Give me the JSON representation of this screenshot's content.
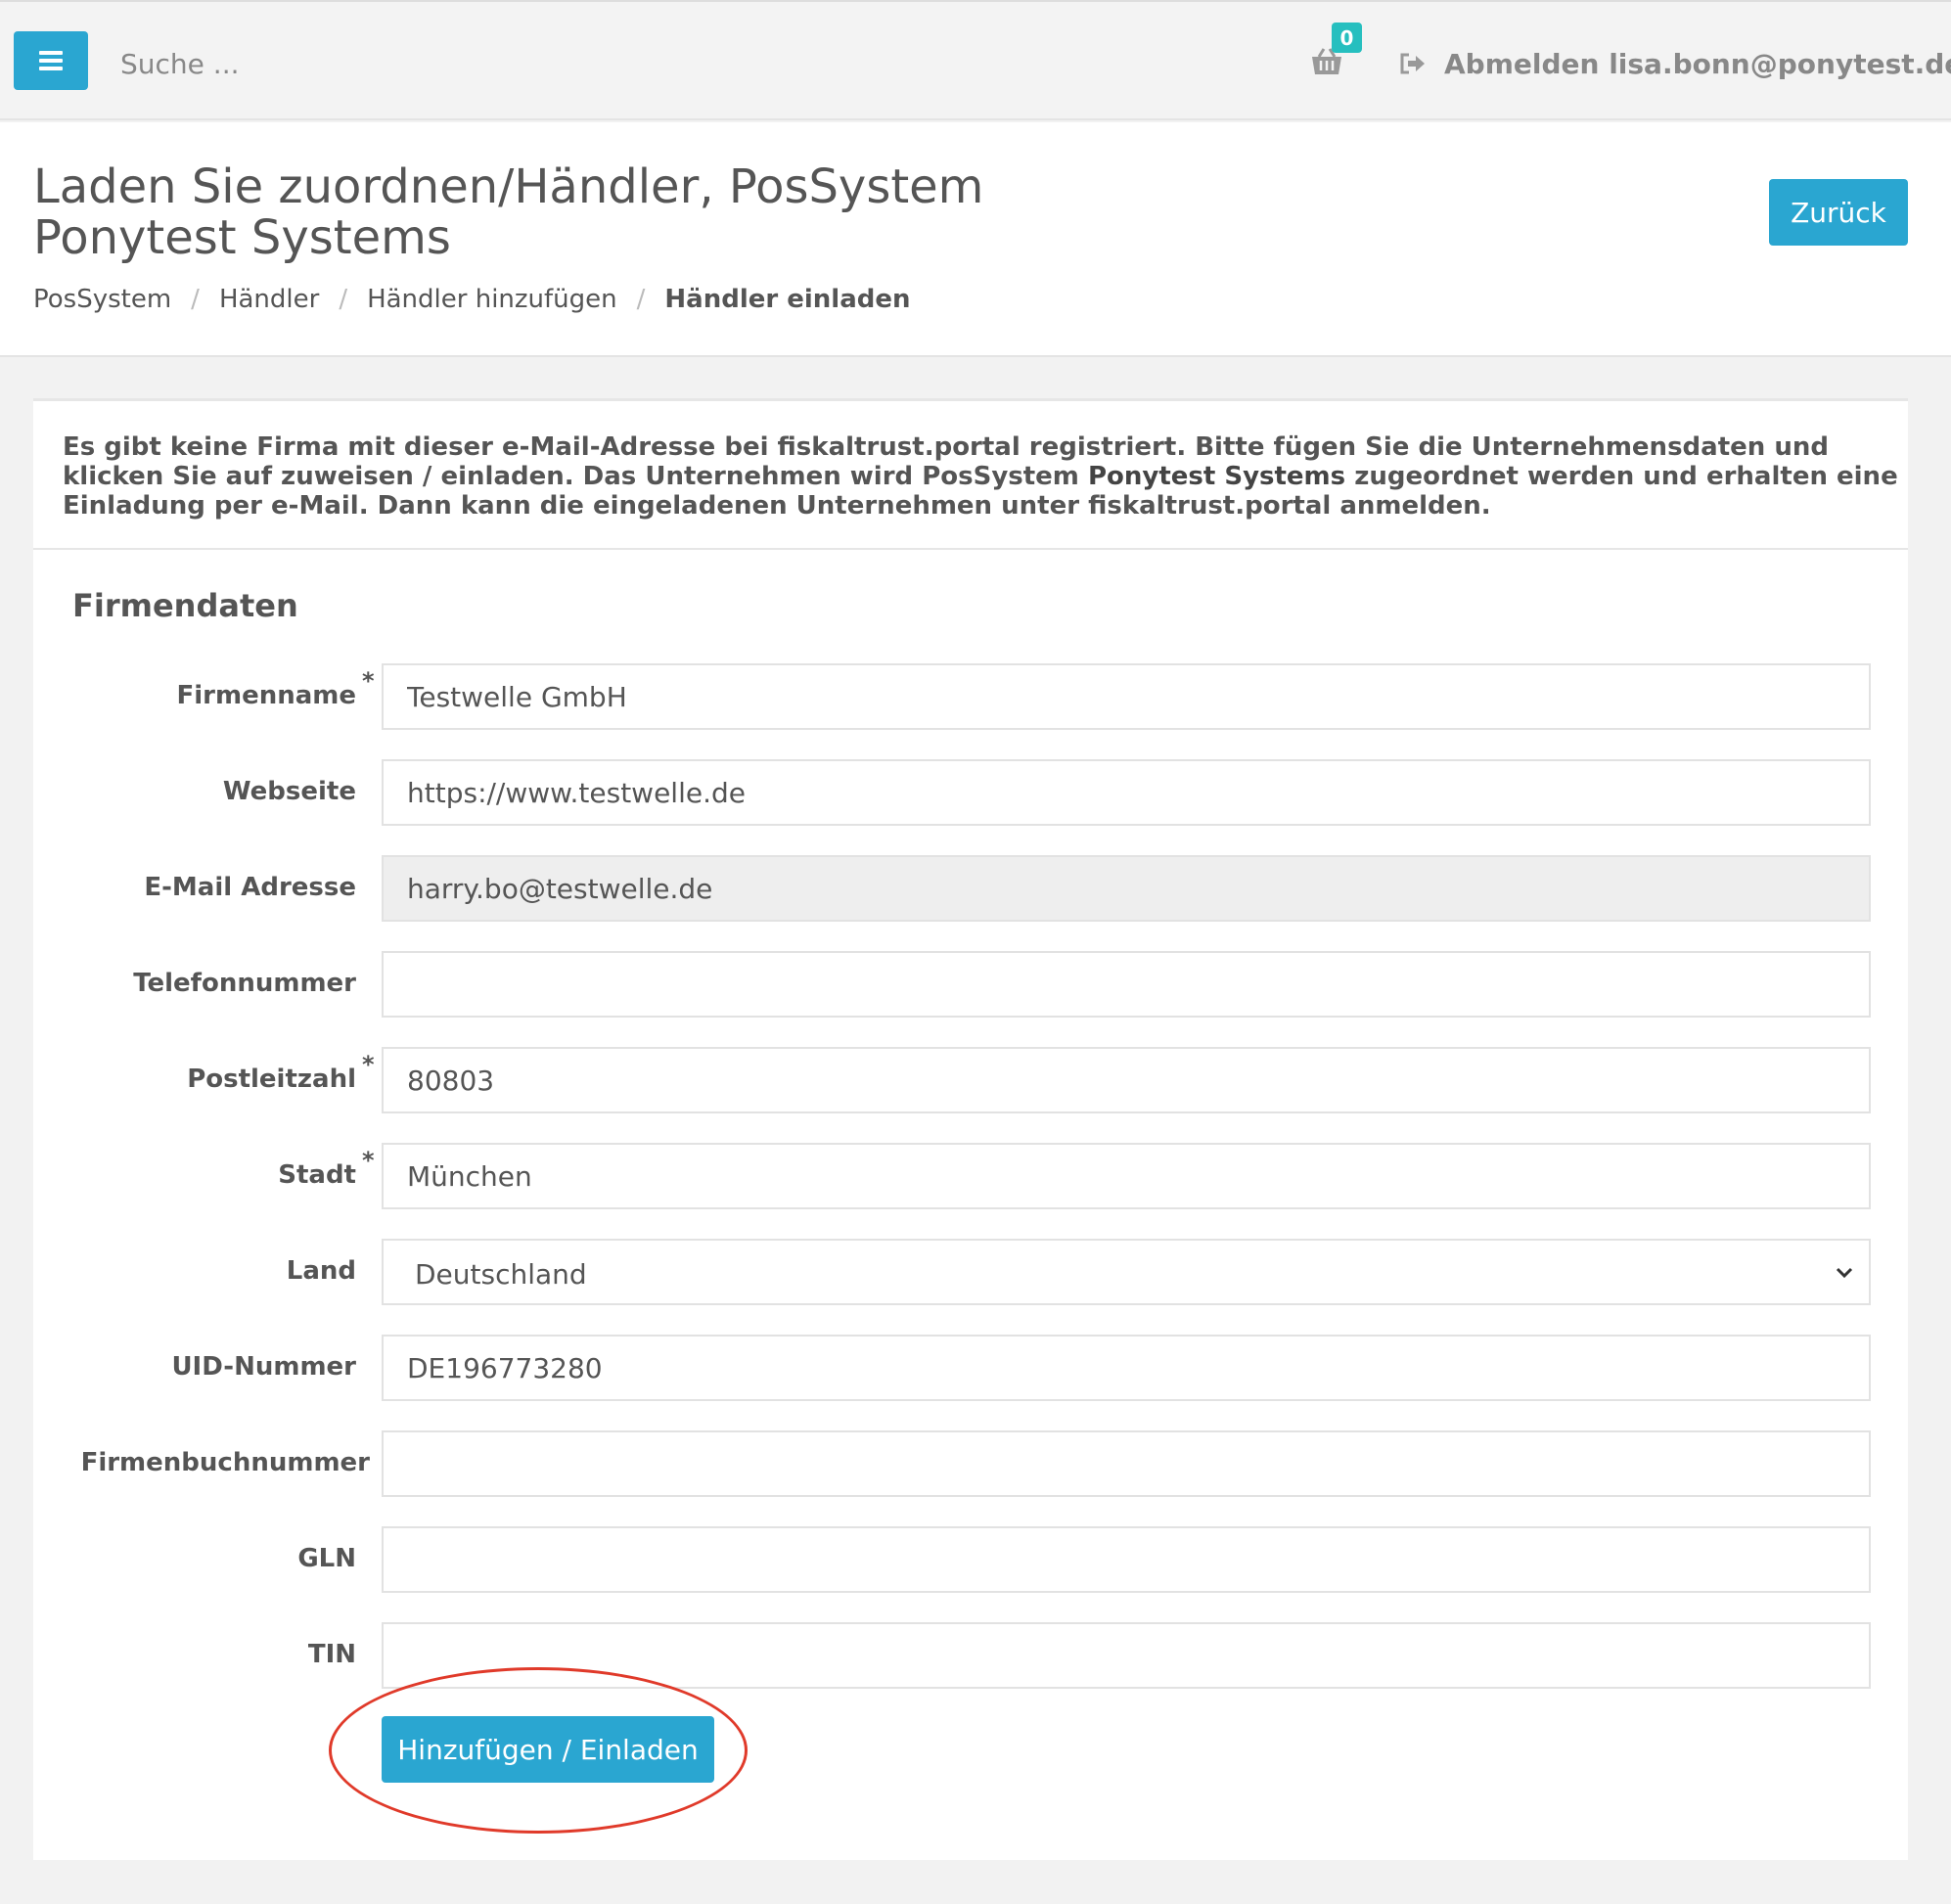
{
  "topbar": {
    "search_placeholder": "Suche ...",
    "cart_count": "0",
    "logout_text": "Abmelden lisa.bonn@ponytest.de"
  },
  "header": {
    "title": "Laden Sie zuordnen/Händler, PosSystem Ponytest Systems",
    "back_label": "Zurück",
    "breadcrumb": [
      "PosSystem",
      "Händler",
      "Händler hinzufügen",
      "Händler einladen"
    ],
    "breadcrumb_separator": "/"
  },
  "notice": {
    "part1": "Es gibt keine Firma mit dieser e-Mail-Adresse bei fiskaltrust.portal registriert. Bitte fügen Sie die Unternehmensdaten und klicken Sie auf zuweisen / einladen. Das Unternehmen wird PosSystem ",
    "bold": "Ponytest Systems",
    "part2": " zugeordnet werden und erhalten eine Einladung per e-Mail. Dann kann die eingeladenen Unternehmen unter fiskaltrust.portal anmelden."
  },
  "form": {
    "section_title": "Firmendaten",
    "required_mark": "*",
    "fields": {
      "firmenname": {
        "label": "Firmenname",
        "value": "Testwelle GmbH"
      },
      "webseite": {
        "label": "Webseite",
        "value": "https://www.testwelle.de"
      },
      "email": {
        "label": "E-Mail Adresse",
        "value": "harry.bo@testwelle.de"
      },
      "telefon": {
        "label": "Telefonnummer",
        "value": ""
      },
      "plz": {
        "label": "Postleitzahl",
        "value": "80803"
      },
      "stadt": {
        "label": "Stadt",
        "value": "München"
      },
      "land": {
        "label": "Land",
        "value": "Deutschland"
      },
      "uid": {
        "label": "UID-Nummer",
        "value": "DE196773280"
      },
      "firmenbuch": {
        "label": "Firmenbuchnummer",
        "value": ""
      },
      "gln": {
        "label": "GLN",
        "value": ""
      },
      "tin": {
        "label": "TIN",
        "value": ""
      }
    },
    "submit_label": "Hinzufügen / Einladen"
  },
  "colors": {
    "accent": "#2aa6d1",
    "badge": "#26bfbf",
    "highlight": "#e03a2a"
  }
}
